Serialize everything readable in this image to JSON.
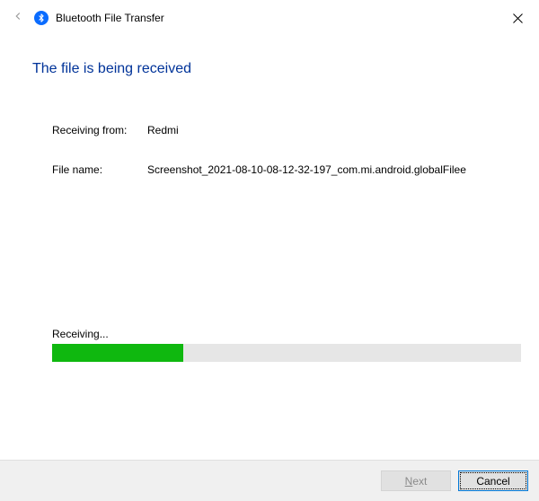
{
  "window": {
    "title": "Bluetooth File Transfer"
  },
  "heading": "The file is being received",
  "info": {
    "receiving_from_label": "Receiving from:",
    "receiving_from_value": "Redmi",
    "file_name_label": "File name:",
    "file_name_value": "Screenshot_2021-08-10-08-12-32-197_com.mi.android.globalFilee"
  },
  "progress": {
    "status_label": "Receiving...",
    "percent": 28
  },
  "buttons": {
    "next_prefix": "N",
    "next_suffix": "ext",
    "cancel": "Cancel"
  }
}
